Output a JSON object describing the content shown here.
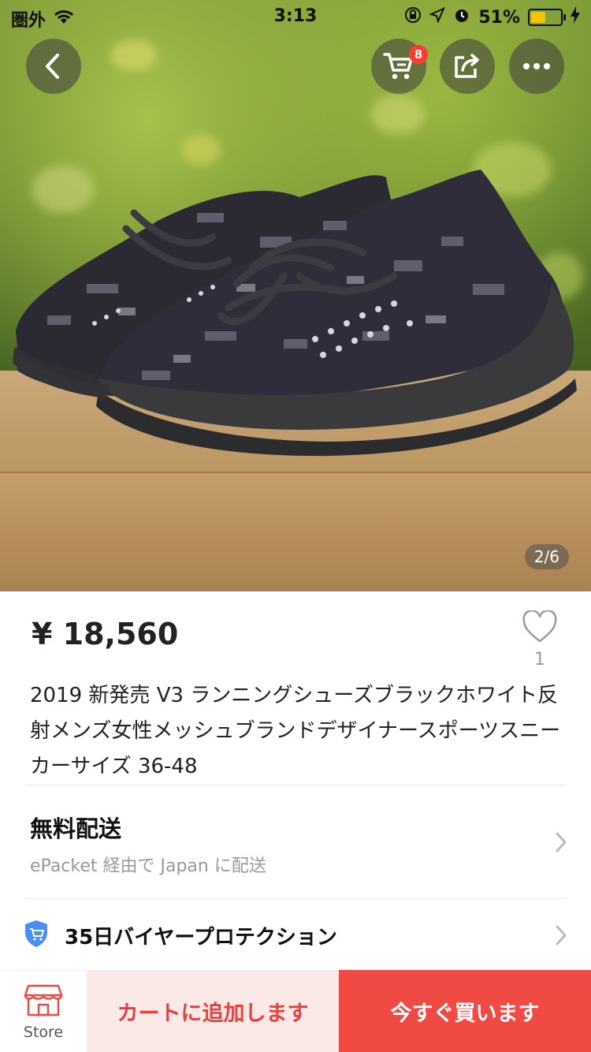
{
  "status_bar": {
    "carrier": "圏外",
    "time": "3:13",
    "battery": "51%",
    "battery_level": 0.51,
    "icons": [
      "wifi-icon",
      "orientation-lock-icon",
      "location-icon",
      "alarm-icon",
      "battery-icon",
      "charging-icon"
    ]
  },
  "top_nav": {
    "cart_count": "8",
    "icons": [
      "back-icon",
      "cart-icon",
      "share-icon",
      "more-icon"
    ]
  },
  "gallery": {
    "indicator": "2/6",
    "current": 2,
    "total": 6
  },
  "product": {
    "price": "¥ 18,560",
    "wishlist_count": "1",
    "title": "2019 新発売 V3 ランニングシューズブラックホワイト反射メンズ女性メッシュブランドデザイナースポーツスニーカーサイズ 36-48"
  },
  "shipping": {
    "title": "無料配送",
    "subtitle": "ePacket 経由で Japan に配送"
  },
  "protection": {
    "label": "35日バイヤープロテクション"
  },
  "bottom_bar": {
    "store_label": "Store",
    "add_to_cart": "カートに追加します",
    "buy_now": "今すぐ買います"
  },
  "colors": {
    "accent_red": "#f04a44",
    "light_red": "#fbe9e8",
    "badge_red": "#ff3b30",
    "protection_blue": "#4a8ef0"
  }
}
